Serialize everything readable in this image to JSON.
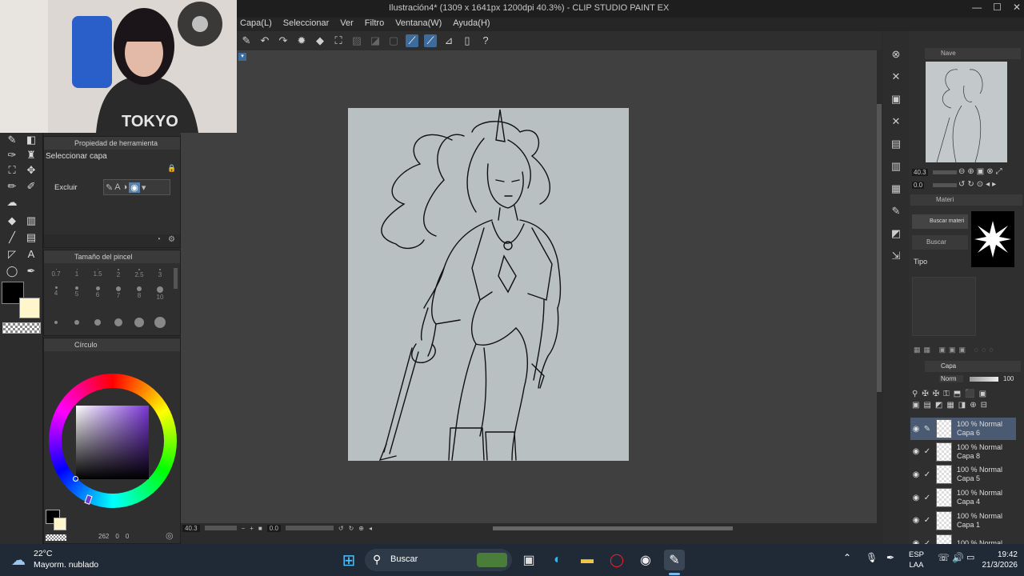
{
  "window": {
    "title": "Ilustración4* (1309 x 1641px 1200dpi 40.3%) - CLIP STUDIO PAINT EX",
    "min": "—",
    "max": "☐",
    "close": "✕"
  },
  "menu": [
    "Capa(L)",
    "Seleccionar",
    "Ver",
    "Filtro",
    "Ventana(W)",
    "Ayuda(H)"
  ],
  "tool_property": {
    "title": "Propiedad de herramienta",
    "tool_name": "Seleccionar capa",
    "exclude_label": "Excluir"
  },
  "brush_size": {
    "title": "Tamaño del pincel",
    "sizes": [
      "0.7",
      "1",
      "1.5",
      "2",
      "2.5",
      "3",
      "4",
      "5",
      "6",
      "7",
      "8",
      "10"
    ]
  },
  "color_panel": {
    "tab": "Círculo",
    "main_color": "#000000",
    "sub_color": "#fff6cc",
    "status_num": "262",
    "status_a": "0",
    "status_b": "0"
  },
  "canvas": {
    "zoom": "40.3",
    "angle": "0.0"
  },
  "navigator": {
    "title": "Nave",
    "zoom": "40.3",
    "angle": "0.0"
  },
  "material": {
    "title": "Materi",
    "search1": "Buscar materi",
    "search2": "Buscar",
    "type_label": "Tipo"
  },
  "layer_panel": {
    "title": "Capa",
    "blend": "Norm",
    "opacity": "100",
    "layers": [
      {
        "mode": "100 % Normal",
        "name": "Capa 6"
      },
      {
        "mode": "100 % Normal",
        "name": "Capa 8"
      },
      {
        "mode": "100 % Normal",
        "name": "Capa 5"
      },
      {
        "mode": "100 % Normal",
        "name": "Capa 4"
      },
      {
        "mode": "100 % Normal",
        "name": "Capa 1"
      },
      {
        "mode": "100 % Normal",
        "name": ""
      }
    ]
  },
  "taskbar": {
    "weather_temp": "22°C",
    "weather_desc": "Mayorm. nublado",
    "search_label": "Buscar",
    "lang_top": "ESP",
    "lang_bottom": "LAA",
    "time": "19:42",
    "date": "21/3/2026"
  },
  "webcam": {
    "shirt_text": "TOKYO"
  }
}
